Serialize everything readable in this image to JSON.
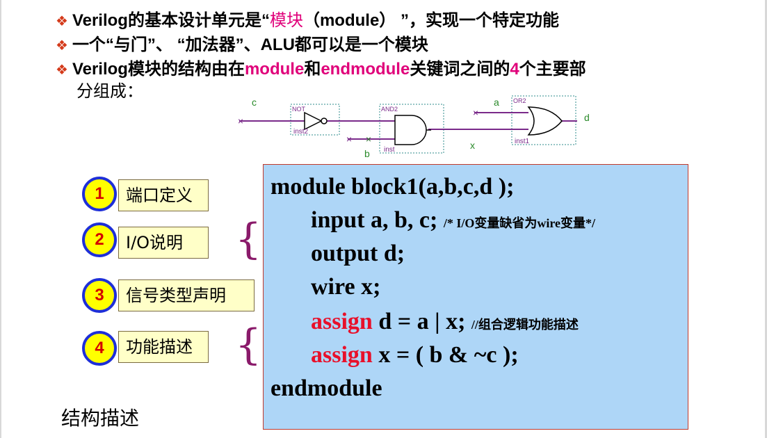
{
  "bullets": [
    {
      "pre": "Verilog的基本设计单元是“",
      "hl": "模块",
      "post": "（module） ”，实现一个特定功能"
    },
    {
      "text": "一个“与门”、 “加法器”、ALU都可以是一个模块"
    },
    {
      "pre": "Verilog模块的结构由在",
      "hl1": "module",
      "mid1": "和",
      "hl2": "endmodule",
      "mid2": "关键词之间的",
      "hl3": "4",
      "post": "个主要部"
    }
  ],
  "bullet3_cont": "分组成：",
  "circuit": {
    "in_c": "c",
    "in_b": "b",
    "in_a": "a",
    "out_d": "d",
    "wire_x": "x",
    "not_name": "NOT",
    "not_inst": "inst2",
    "and_name": "AND2",
    "and_inst": "inst",
    "or_name": "OR2",
    "or_inst": "inst1"
  },
  "parts": [
    {
      "num": "1",
      "label": "端口定义"
    },
    {
      "num": "2",
      "label": "I/O说明"
    },
    {
      "num": "3",
      "label": "信号类型声明"
    },
    {
      "num": "4",
      "label": "功能描述"
    }
  ],
  "brace": "{",
  "code": {
    "line1": "module block1(a,b,c,d );",
    "line2": "input a, b, c;",
    "line2_comment": "/* I/O变量缺省为wire变量*/",
    "line3": "output d;",
    "line4": "wire x;",
    "line5_kw": "assign",
    "line5": " d = a | x;",
    "line5_comment": "//组合逻辑功能描述",
    "line6_kw": "assign",
    "line6": " x = ( b & ~c );",
    "line7": "endmodule"
  },
  "footer": "结构描述",
  "colors": {
    "highlight": "#e0007a",
    "keyword": "#e8102a",
    "code_bg": "#aed6f7",
    "circle": "#ffff00",
    "circle_border": "#1e2fd8"
  }
}
